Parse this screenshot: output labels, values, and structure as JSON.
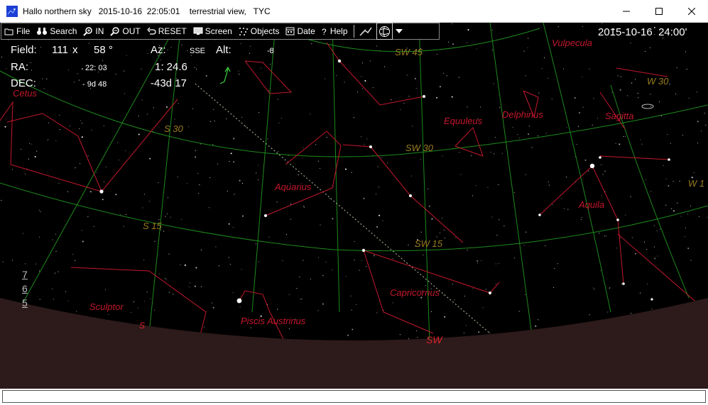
{
  "window": {
    "title": "Hallo northern sky   2015-10-16  22:05:01    terrestrial view,   TYC",
    "buttons": [
      "minimize",
      "maximize",
      "close"
    ]
  },
  "toolbar": {
    "file": "File",
    "search": "Search",
    "zoom_in": "IN",
    "zoom_out": "OUT",
    "reset": "RESET",
    "screen": "Screen",
    "objects": "Objects",
    "date": "Date",
    "help": "Help"
  },
  "info": {
    "field_label": "Field:",
    "field_w": "111",
    "field_x": "x",
    "field_h": "58 °",
    "az_label": "Az:",
    "az_value": "SSE",
    "alt_label": "Alt:",
    "alt_value": "-8",
    "ra_label": "RA:",
    "ra_value_small": "22: 03",
    "ra_value": "1: 24.6",
    "dec_label": "DEC:",
    "dec_value_small": "- 9d 48",
    "dec_value": "-43d 17"
  },
  "datetime": "2015-10-16  24:00'",
  "scale_marks": [
    "7",
    "6",
    "5"
  ],
  "constellations": [
    "Vulpecula",
    "Cetus",
    "Equuleus",
    "Delphinus",
    "Sagitta",
    "Aquarius",
    "Aquila",
    "Sculptor",
    "Capricornus",
    "Piscis  Austrinus"
  ],
  "grid_labels": [
    "SW 45",
    "W 30",
    "S 30",
    "SW 30",
    "W 1",
    "S 15",
    "SW 15"
  ],
  "horizon_labels": [
    "SW",
    "S"
  ],
  "status_text": "",
  "colors": {
    "sky": "#000000",
    "ground": "#2d1a1a",
    "constellation": "#c4182c",
    "grid": "#1d8a1d",
    "grid_label": "#9a7b1e",
    "ecliptic": "#b9c7a0"
  }
}
